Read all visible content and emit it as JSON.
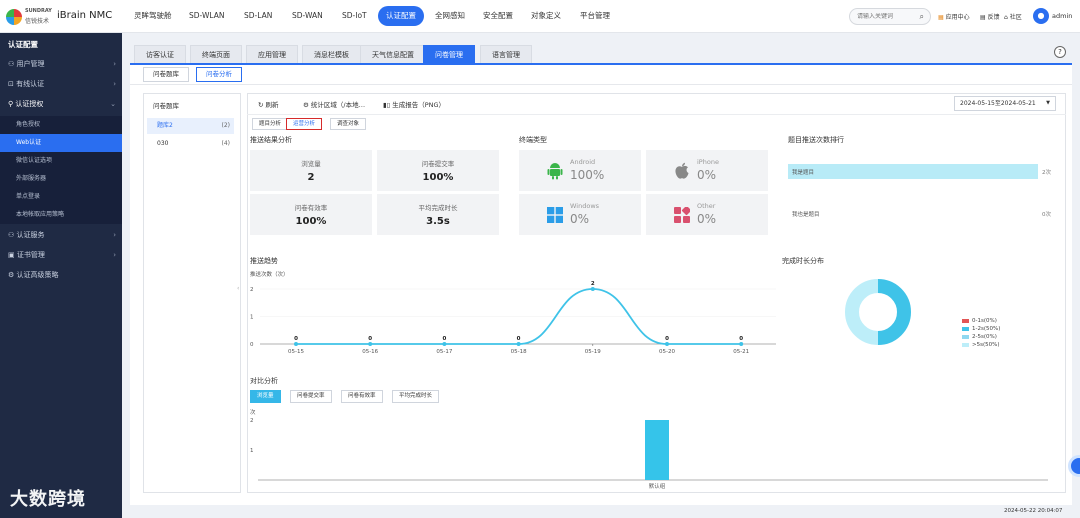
{
  "header": {
    "logo_line1": "SUNDRAY",
    "logo_line2": "信锐技术",
    "product": "iBrain NMC",
    "nav": [
      "灵眸驾驶舱",
      "SD-WLAN",
      "SD-LAN",
      "SD-WAN",
      "SD-IoT",
      "认证配置",
      "全网感知",
      "安全配置",
      "对象定义",
      "平台管理"
    ],
    "active_nav": "认证配置",
    "search_placeholder": "请输入关键词",
    "tools": {
      "app_center": "应用中心",
      "feedback": "反馈",
      "community": "社区"
    },
    "user": "admin"
  },
  "sidebar": {
    "title": "认证配置",
    "groups": [
      {
        "label": "用户管理"
      },
      {
        "label": "有线认证"
      },
      {
        "label": "认证授权"
      }
    ],
    "sub_items": [
      "角色授权",
      "Web认证",
      "微信认证选项",
      "外部服务器",
      "单点登录",
      "本地帐取应用策略"
    ],
    "groups_after": [
      {
        "label": "认证服务"
      },
      {
        "label": "证书管理"
      },
      {
        "label": "认证高级策略"
      }
    ]
  },
  "tabs": [
    "访客认证",
    "终端页面",
    "应用管理",
    "消息栏模板",
    "天气信息配置",
    "问卷管理",
    "语言管理"
  ],
  "active_tab": "问卷管理",
  "subtabs": [
    "问卷题库",
    "问卷分析"
  ],
  "active_subtab": "问卷分析",
  "left_list": {
    "title": "问卷题库",
    "items": [
      {
        "label": "题库2",
        "count": "(2)"
      },
      {
        "label": "030",
        "count": "(4)"
      }
    ]
  },
  "toolbar": {
    "refresh": "刷新",
    "stat_area": "统计区域（/本地…",
    "generate": "生成报告（PNG）",
    "date_range": "2024-05-15至2024-05-21"
  },
  "analysis_tabs": [
    "题目分析",
    "运营分析",
    "调查对象"
  ],
  "active_analysis_tab": "运营分析",
  "push_result": {
    "title": "推送结果分析",
    "stats": [
      {
        "label": "浏览量",
        "value": "2"
      },
      {
        "label": "问卷提交率",
        "value": "100%"
      },
      {
        "label": "问卷有效率",
        "value": "100%"
      },
      {
        "label": "平均完成时长",
        "value": "3.5s"
      }
    ]
  },
  "terminal": {
    "title": "终端类型",
    "items": [
      {
        "label": "Android",
        "value": "100%",
        "icon": "android-icon",
        "color": "#3bb54a"
      },
      {
        "label": "iPhone",
        "value": "0%",
        "icon": "apple-icon",
        "color": "#888888"
      },
      {
        "label": "Windows",
        "value": "0%",
        "icon": "windows-icon",
        "color": "#2b9de8"
      },
      {
        "label": "Other",
        "value": "0%",
        "icon": "other-icon",
        "color": "#d9506e"
      }
    ]
  },
  "rank": {
    "title": "题目推送次数排行",
    "items": [
      {
        "label": "我是题目",
        "count": "2次",
        "fraction": 1.0
      },
      {
        "label": "我也是题目",
        "count": "0次",
        "fraction": 0.0
      }
    ]
  },
  "trend": {
    "title": "推送趋势",
    "ylabel": "推送次数（次）"
  },
  "duration": {
    "title": "完成时长分布",
    "legend": [
      {
        "label": "0-1s(0%)",
        "color": "#e25555",
        "value": 0
      },
      {
        "label": "1-2s(50%)",
        "color": "#3fc3e8",
        "value": 50
      },
      {
        "label": "2-5s(0%)",
        "color": "#8fd8f0",
        "value": 0
      },
      {
        "label": ">5s(50%)",
        "color": "#bdeef9",
        "value": 50
      }
    ]
  },
  "compare": {
    "title": "对比分析",
    "buttons": [
      "浏览量",
      "问卷提交率",
      "问卷有效率",
      "平均完成时长"
    ],
    "active": "浏览量",
    "ylabel": "次"
  },
  "chart_data": [
    {
      "type": "line",
      "title": "推送趋势",
      "ylabel": "推送次数（次）",
      "x": [
        "05-15",
        "05-16",
        "05-17",
        "05-18",
        "05-19",
        "05-20",
        "05-21"
      ],
      "series": [
        {
          "values": [
            0,
            0,
            0,
            0,
            2,
            0,
            0
          ]
        }
      ],
      "ylim": [
        0,
        2
      ],
      "yticks": [
        0,
        1,
        2
      ],
      "data_labels": true,
      "color": "#3fc3e8"
    },
    {
      "type": "bar",
      "ylabel": "次",
      "categories": [
        "默认组"
      ],
      "values": [
        2
      ],
      "ylim": [
        0,
        2
      ],
      "yticks": [
        1,
        2
      ],
      "color": "#35c4ea"
    }
  ],
  "footer": {
    "time": "2024-05-22 20:04:07"
  },
  "watermark": "大数跨境"
}
